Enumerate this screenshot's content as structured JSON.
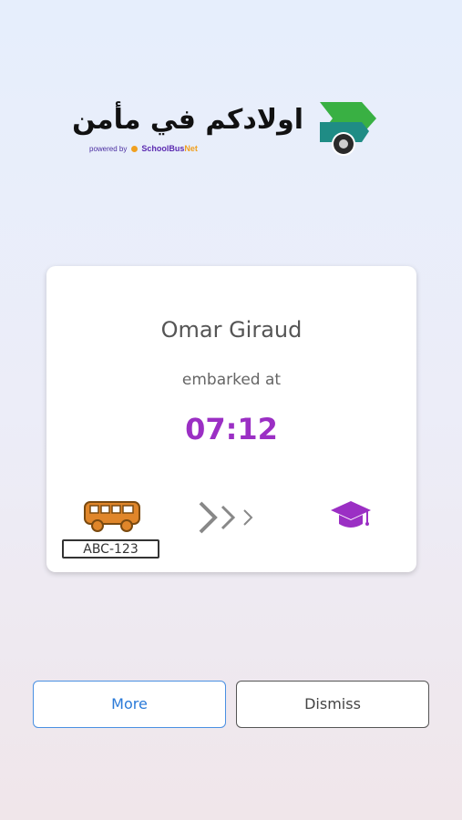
{
  "logo": {
    "arabic_text": "اولادكم في مأمن",
    "powered_by": "powered by",
    "brand_school": "SchoolBus",
    "brand_net": "Net",
    "colors": {
      "green": "#3aab3a",
      "teal": "#1a8a86"
    }
  },
  "card": {
    "student_name": "Omar Giraud",
    "event_text": "embarked at",
    "time": "07:12",
    "plate_number": "ABC-123",
    "icons": {
      "vehicle": "bus-icon",
      "progress": "arrows-icon",
      "destination": "graduation-cap-icon"
    },
    "accent_color": "#9b2fc4"
  },
  "actions": {
    "more_label": "More",
    "dismiss_label": "Dismiss"
  }
}
